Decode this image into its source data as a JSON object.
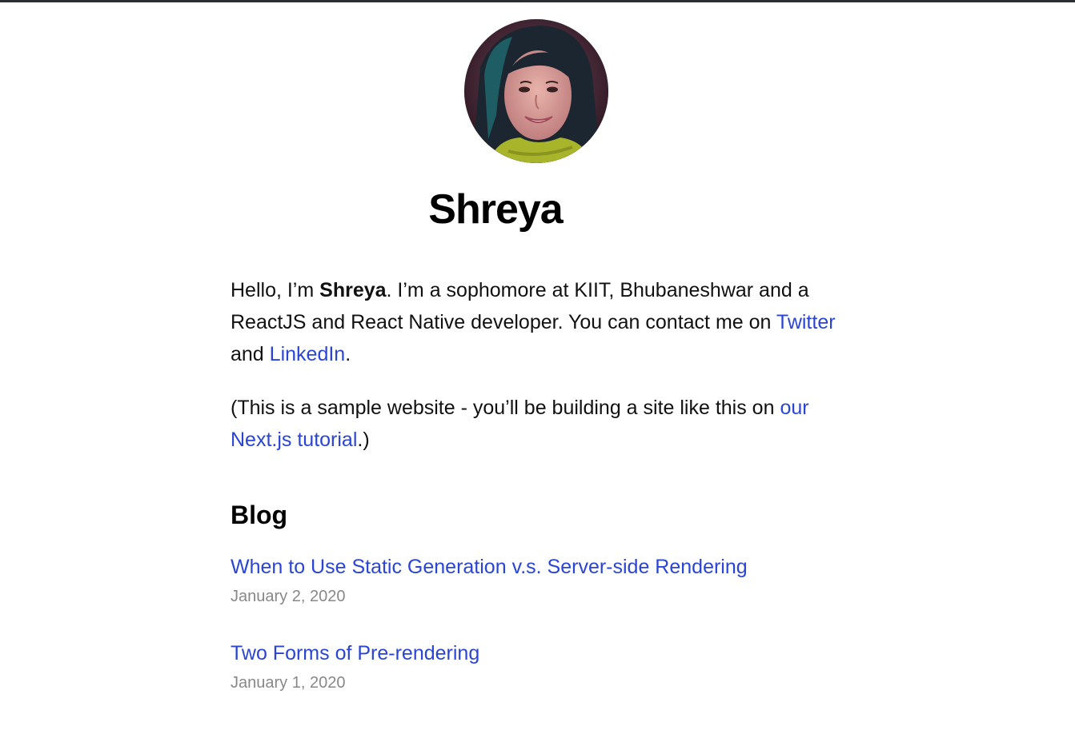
{
  "header": {
    "name": "Shreya",
    "avatar_alt": "Shreya"
  },
  "intro": {
    "part1": "Hello, I’m ",
    "name_bold": "Shreya",
    "part2": ". I’m a sophomore at KIIT, Bhubaneshwar and a ReactJS and React Native developer. You can contact me on ",
    "twitter_label": "Twitter",
    "part3": " and ",
    "linkedin_label": "LinkedIn",
    "part4": "."
  },
  "note": {
    "part1": "(This is a sample website - you’ll be building a site like this on ",
    "tutorial_label": "our Next.js tutorial",
    "part2": ".)"
  },
  "blog": {
    "heading": "Blog",
    "posts": [
      {
        "title": "When to Use Static Generation v.s. Server-side Rendering",
        "date": "January 2, 2020"
      },
      {
        "title": "Two Forms of Pre-rendering",
        "date": "January 1, 2020"
      }
    ]
  },
  "colors": {
    "link": "#2a45d6",
    "date": "#888888",
    "top_border": "#2b2f33"
  }
}
